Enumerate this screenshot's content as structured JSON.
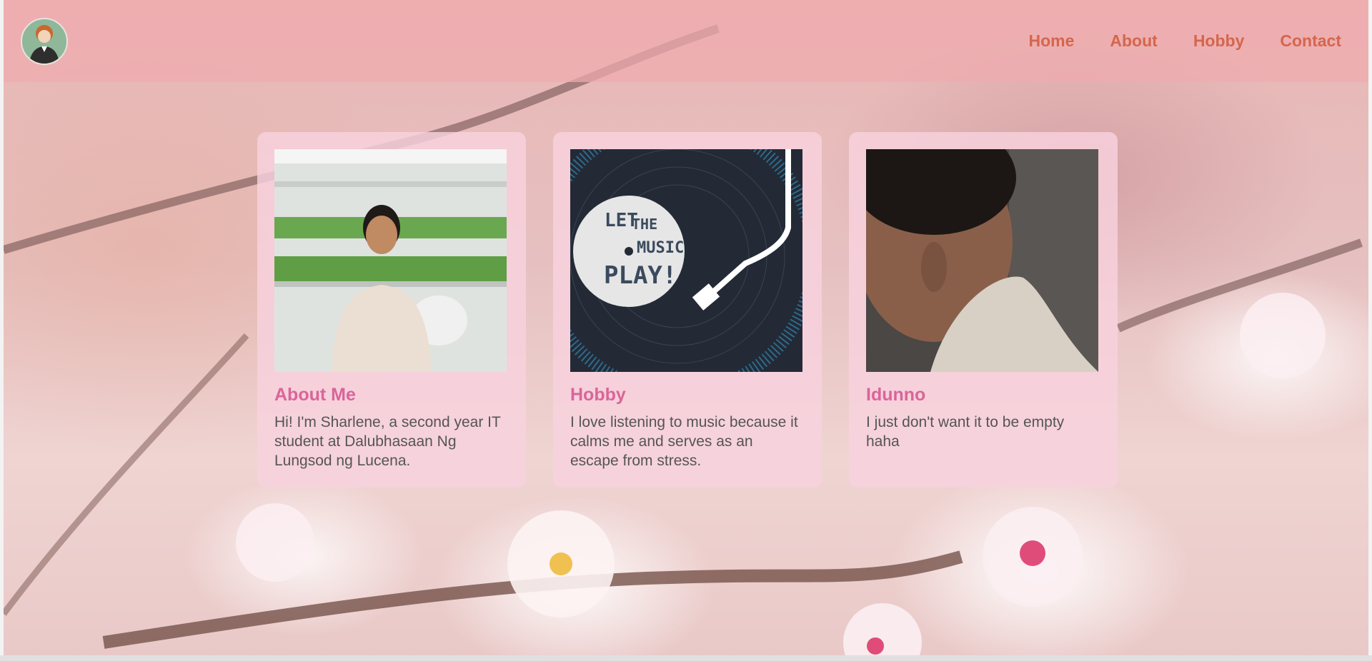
{
  "nav": {
    "logo_alt": "avatar",
    "links": [
      {
        "label": "Home"
      },
      {
        "label": "About"
      },
      {
        "label": "Hobby"
      },
      {
        "label": "Contact"
      }
    ]
  },
  "cards": [
    {
      "image": "photo-of-girl-laughing-in-greenhouse",
      "title": "About Me",
      "text": "Hi! I'm Sharlene, a second year IT student at Dalubhasaan Ng Lungsod ng Lucena."
    },
    {
      "image": "turntable-vinyl-record-illustration",
      "title": "Hobby",
      "text": "I love listening to music because it calms me and serves as an escape from stress.",
      "record_label": [
        "LET",
        "THE",
        "MUSIC",
        "PLAY!"
      ]
    },
    {
      "image": "photo-of-person-in-hoodie",
      "title": "Idunno",
      "text": "I just don't want it to be empty haha"
    }
  ],
  "colors": {
    "nav_link": "#d4664d",
    "card_title": "#d9659a",
    "card_bg": "#f8d2de"
  }
}
